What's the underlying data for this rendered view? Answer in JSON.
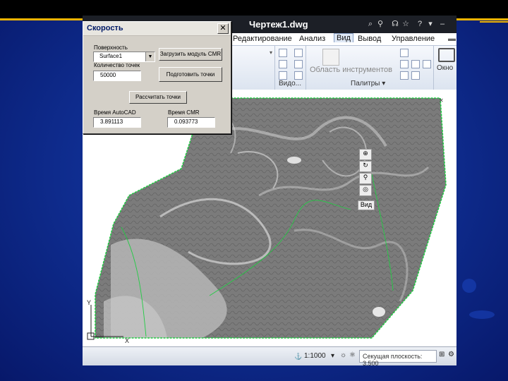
{
  "window": {
    "title": "Чертеж1.dwg",
    "ribbon_tabs": [
      "Редактирование",
      "Анализ",
      "Вид",
      "Вывод",
      "Управление"
    ],
    "active_tab": "Вид",
    "tool_area_label": "Область инструментов",
    "panels": [
      "Видо...",
      "Палитры ▾"
    ],
    "right_panel_label": "Окно"
  },
  "dialog": {
    "title": "Скорость",
    "close_label": "✕",
    "surface_label": "Поверхность",
    "surface_value": "Surface1",
    "points_count_label": "Количество точек",
    "points_count_value": "50000",
    "load_cmr_button": "Загрузить модуль CMR",
    "prepare_points_button": "Подготовить точки",
    "compute_button": "Рассчитать точки",
    "autocad_time_label": "Время AutoCAD",
    "autocad_time_value": "3.891113",
    "cmr_time_label": "Время CMR",
    "cmr_time_value": "0.093773"
  },
  "nav_tools": {
    "view_label": "Вид"
  },
  "status": {
    "scale": "1:1000",
    "contour_interval": "Секущая плоскость: 3.500"
  },
  "ucs": {
    "y": "Y",
    "x": "X"
  },
  "colors": {
    "boundary": "#22cc44",
    "terrain": "#7a7a7a",
    "background": "#0e2b8c",
    "accent": "#f0b400"
  }
}
